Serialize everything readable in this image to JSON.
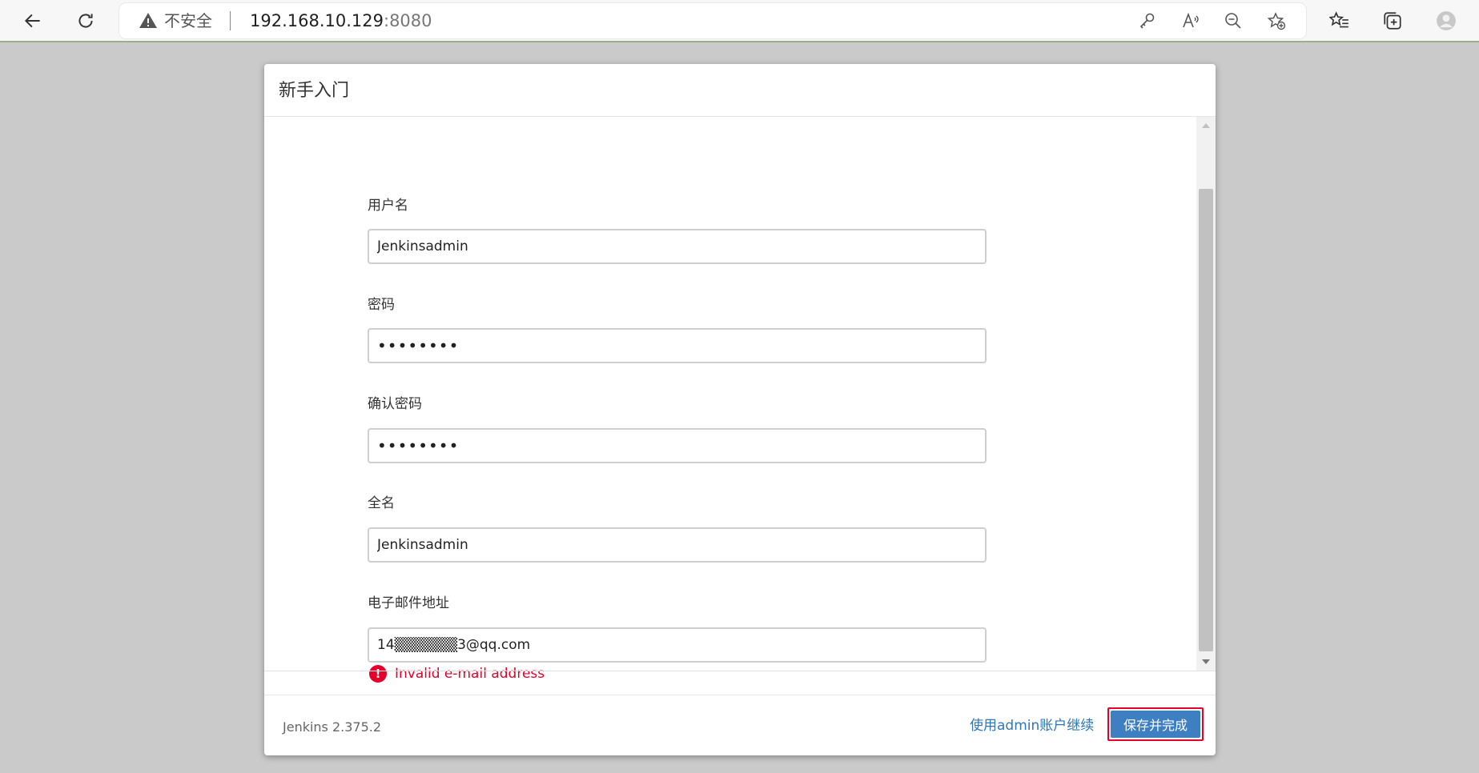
{
  "browser": {
    "security_label": "不安全",
    "url_host": "192.168.10.129",
    "url_port": ":8080",
    "icons": [
      "back-icon",
      "refresh-icon",
      "warning-icon",
      "key-icon",
      "read-aloud-icon",
      "zoom-out-icon",
      "add-favorite-icon",
      "favorites-icon",
      "collections-icon",
      "profile-icon"
    ]
  },
  "dialog": {
    "title": "新手入门",
    "fields": {
      "username": {
        "label": "用户名",
        "value": "Jenkinsadmin"
      },
      "password": {
        "label": "密码",
        "value": "••••••••"
      },
      "confirm_password": {
        "label": "确认密码",
        "value": "••••••••"
      },
      "full_name": {
        "label": "全名",
        "value": "Jenkinsadmin"
      },
      "email": {
        "label": "电子邮件地址",
        "value": "14▒▒▒▒▒▒3@qq.com"
      }
    },
    "error": {
      "icon": "!",
      "text": "Invalid e-mail address"
    },
    "footer": {
      "version": "Jenkins 2.375.2",
      "continue_link": "使用admin账户继续",
      "save_button": "保存并完成"
    }
  },
  "colors": {
    "error": "#e4002b",
    "primary": "#3d7fc1",
    "link": "#2d76b9",
    "backdrop": "#cacaca"
  }
}
